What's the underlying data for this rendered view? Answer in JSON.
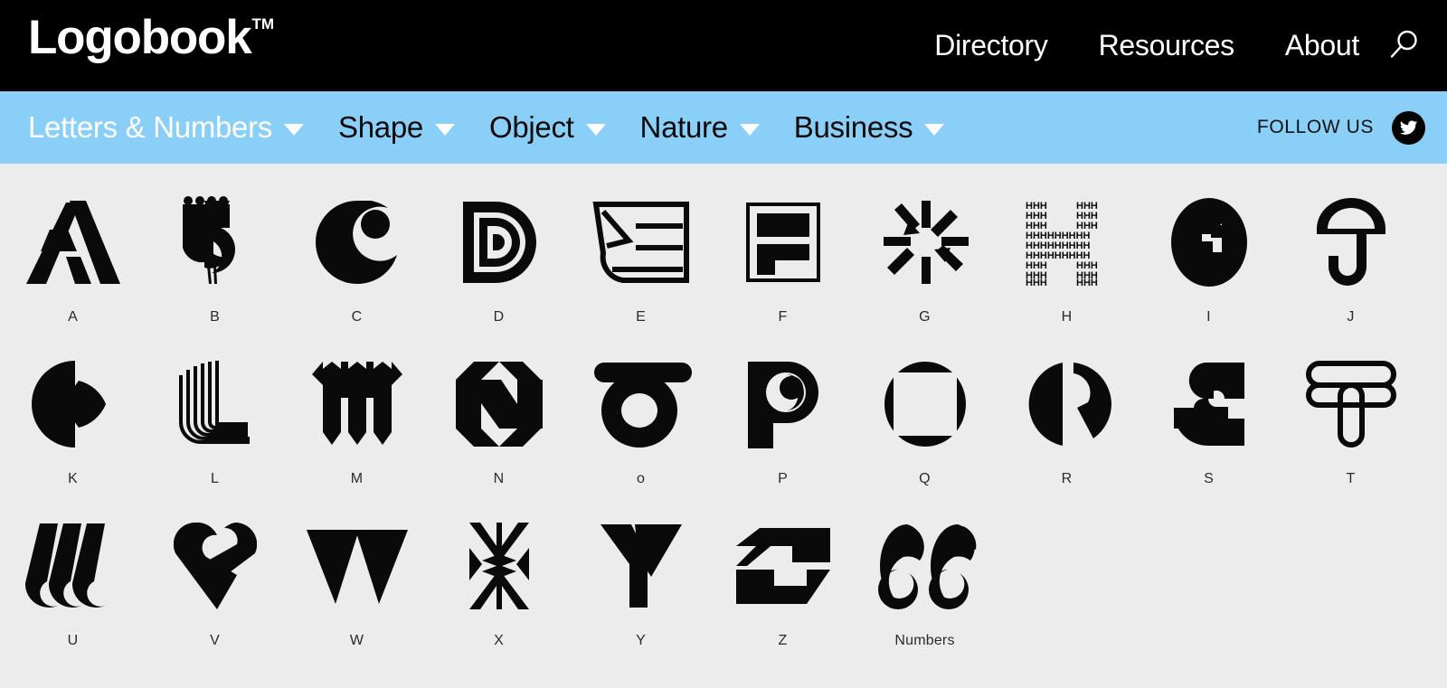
{
  "header": {
    "brand_name": "Logobook",
    "brand_tm": "TM",
    "nav": [
      {
        "label": "Directory"
      },
      {
        "label": "Resources"
      },
      {
        "label": "About"
      }
    ],
    "search_icon": "search-icon"
  },
  "subnav": {
    "categories": [
      {
        "label": "Letters & Numbers",
        "active": true
      },
      {
        "label": "Shape",
        "active": false
      },
      {
        "label": "Object",
        "active": false
      },
      {
        "label": "Nature",
        "active": false
      },
      {
        "label": "Business",
        "active": false
      }
    ],
    "follow_label": "FOLLOW US",
    "social_icon": "twitter-icon"
  },
  "grid": {
    "rows": [
      [
        {
          "label": "A",
          "art": "a-mark"
        },
        {
          "label": "B",
          "art": "b-mark"
        },
        {
          "label": "C",
          "art": "c-mark"
        },
        {
          "label": "D",
          "art": "d-mark"
        },
        {
          "label": "E",
          "art": "e-mark"
        },
        {
          "label": "F",
          "art": "f-mark"
        },
        {
          "label": "G",
          "art": "g-mark"
        },
        {
          "label": "H",
          "art": "h-mark"
        },
        {
          "label": "I",
          "art": "i-mark"
        },
        {
          "label": "J",
          "art": "j-mark"
        }
      ],
      [
        {
          "label": "K",
          "art": "k-mark"
        },
        {
          "label": "L",
          "art": "l-mark"
        },
        {
          "label": "M",
          "art": "m-mark"
        },
        {
          "label": "N",
          "art": "n-mark"
        },
        {
          "label": "o",
          "art": "o-mark"
        },
        {
          "label": "P",
          "art": "p-mark"
        },
        {
          "label": "Q",
          "art": "q-mark"
        },
        {
          "label": "R",
          "art": "r-mark"
        },
        {
          "label": "S",
          "art": "s-mark"
        },
        {
          "label": "T",
          "art": "t-mark"
        }
      ],
      [
        {
          "label": "U",
          "art": "u-mark"
        },
        {
          "label": "V",
          "art": "v-mark"
        },
        {
          "label": "W",
          "art": "w-mark"
        },
        {
          "label": "X",
          "art": "x-mark"
        },
        {
          "label": "Y",
          "art": "y-mark"
        },
        {
          "label": "Z",
          "art": "z-mark"
        },
        {
          "label": "Numbers",
          "art": "numbers-mark"
        }
      ]
    ]
  },
  "colors": {
    "header_bg": "#000000",
    "subnav_bg": "#8ACFF8",
    "page_bg": "#ececec",
    "mark_color": "#0a0a0a",
    "label_color": "#2b2b2b",
    "active_category": "#ffffff"
  }
}
